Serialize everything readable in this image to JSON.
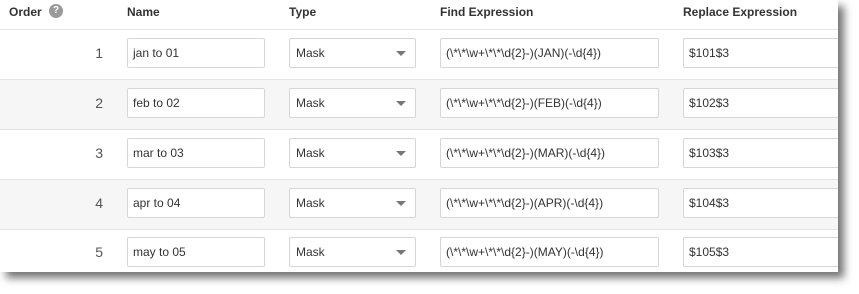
{
  "header": {
    "order": "Order",
    "help_glyph": "?",
    "name": "Name",
    "type": "Type",
    "find": "Find Expression",
    "replace": "Replace Expression"
  },
  "rows": [
    {
      "order": "1",
      "name": "jan to 01",
      "type": "Mask",
      "find": "(\\*\\*\\w+\\*\\*\\d{2}-)(JAN)(-\\d{4})",
      "replace": "$101$3"
    },
    {
      "order": "2",
      "name": "feb to 02",
      "type": "Mask",
      "find": "(\\*\\*\\w+\\*\\*\\d{2}-)(FEB)(-\\d{4})",
      "replace": "$102$3"
    },
    {
      "order": "3",
      "name": "mar to 03",
      "type": "Mask",
      "find": "(\\*\\*\\w+\\*\\*\\d{2}-)(MAR)(-\\d{4})",
      "replace": "$103$3"
    },
    {
      "order": "4",
      "name": "apr to 04",
      "type": "Mask",
      "find": "(\\*\\*\\w+\\*\\*\\d{2}-)(APR)(-\\d{4})",
      "replace": "$104$3"
    },
    {
      "order": "5",
      "name": "may to 05",
      "type": "Mask",
      "find": "(\\*\\*\\w+\\*\\*\\d{2}-)(MAY)(-\\d{4})",
      "replace": "$105$3"
    }
  ],
  "colors": {
    "help_icon": "#9a9a9a",
    "row_alt": "#f6f6f6",
    "border": "#d6d6d6"
  },
  "icons": {
    "help": "help-circle-icon",
    "dropdown": "chevron-down-icon"
  }
}
